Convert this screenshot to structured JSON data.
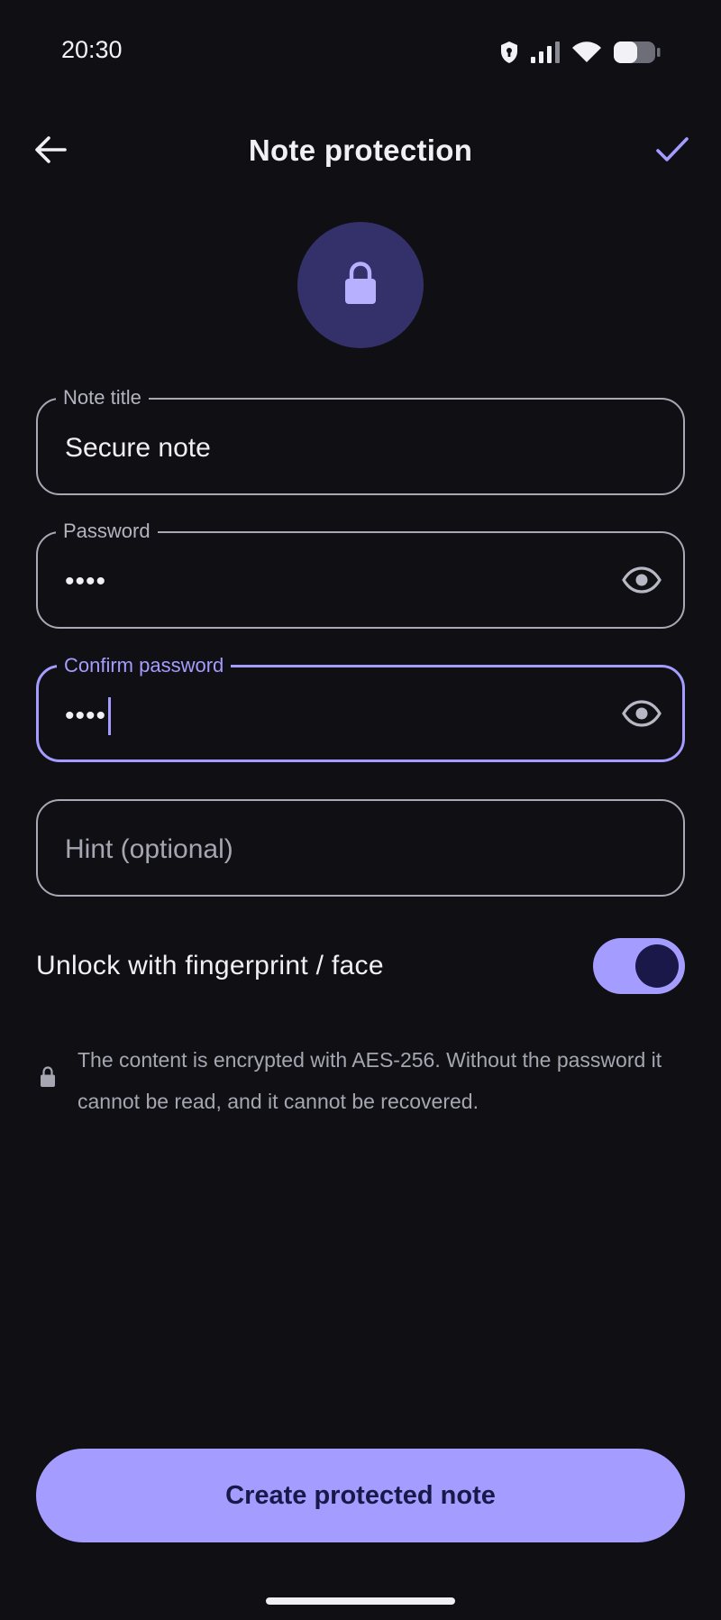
{
  "status_bar": {
    "time": "20:30"
  },
  "app_bar": {
    "title": "Note protection"
  },
  "form": {
    "title_field": {
      "label": "Note title",
      "value": "Secure note"
    },
    "password_field": {
      "label": "Password",
      "value": "••••"
    },
    "confirm_field": {
      "label": "Confirm password",
      "value": "••••"
    },
    "hint_field": {
      "placeholder": "Hint (optional)"
    }
  },
  "biometric": {
    "label": "Unlock with fingerprint / face",
    "enabled": true
  },
  "info": {
    "text": "The content is encrypted with AES-256. Without the password it cannot be read, and it cannot be recovered."
  },
  "actions": {
    "create_label": "Create protected note"
  },
  "colors": {
    "accent": "#a49cff",
    "background": "#0f0f14",
    "lock_circle": "#34316a"
  }
}
